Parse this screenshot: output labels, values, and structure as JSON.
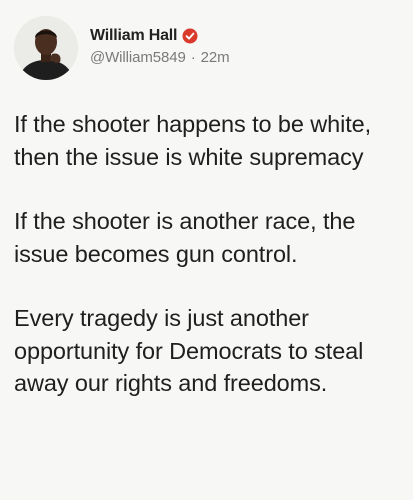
{
  "author": {
    "display_name": "William Hall",
    "handle": "@William5849",
    "time_separator": "·",
    "time": "22m",
    "verified_icon": "verified-badge-icon",
    "verified_color": "#d93a2b"
  },
  "tweet": {
    "paragraphs": [
      "If the shooter happens to be white, then the issue is white supremacy",
      "If the shooter is another race, the issue becomes gun control.",
      "Every tragedy is just another opportunity for Democrats to steal away our rights and freedoms."
    ]
  }
}
